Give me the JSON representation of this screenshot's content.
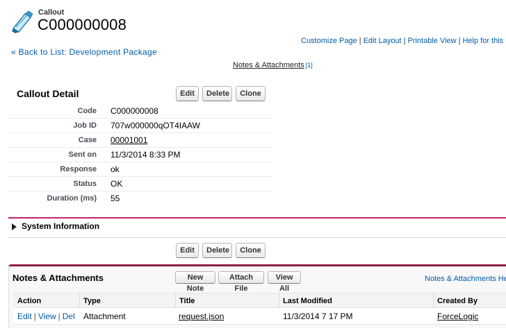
{
  "header": {
    "object_type": "Callout",
    "record_name": "C000000008",
    "icon": "callout-record-icon"
  },
  "page_links": [
    "Customize Page",
    "Edit Layout",
    "Printable View",
    "Help for this Pa"
  ],
  "back_link": "« Back to List: Development Package",
  "related_list_link": {
    "label": "Notes & Attachments",
    "count": "[1]"
  },
  "detail": {
    "title": "Callout Detail",
    "buttons": {
      "edit": "Edit",
      "delete": "Delete",
      "clone": "Clone"
    },
    "fields": [
      {
        "label": "Code",
        "value": "C000000008"
      },
      {
        "label": "Job ID",
        "value": "707w000000qOT4IAAW"
      },
      {
        "label": "Case",
        "value": "00001001"
      },
      {
        "label": "Sent on",
        "value": "11/3/2014 8:33 PM"
      },
      {
        "label": "Response",
        "value": "ok"
      },
      {
        "label": "Status",
        "value": "OK"
      },
      {
        "label": "Duration (ms)",
        "value": "55"
      }
    ]
  },
  "system_information": {
    "title": "System Information"
  },
  "bottom_buttons": {
    "edit": "Edit",
    "delete": "Delete",
    "clone": "Clone"
  },
  "notes_attachments": {
    "title": "Notes & Attachments",
    "buttons": {
      "new_note": "New Note",
      "attach_file": "Attach File",
      "view_all": "View All"
    },
    "help_link": "Notes & Attachments He",
    "columns": [
      "Action",
      "Type",
      "Title",
      "Last Modified",
      "Created By"
    ],
    "rows": [
      {
        "actions": [
          "Edit",
          "View",
          "Del"
        ],
        "type": "Attachment",
        "title": "request.json",
        "last_modified": "11/3/2014 7 17 PM",
        "created_by": "ForceLogic"
      }
    ]
  },
  "colors": {
    "link": "#015ba7",
    "accent_pink": "#c0226f",
    "related_list_border": "#8a1f45"
  }
}
